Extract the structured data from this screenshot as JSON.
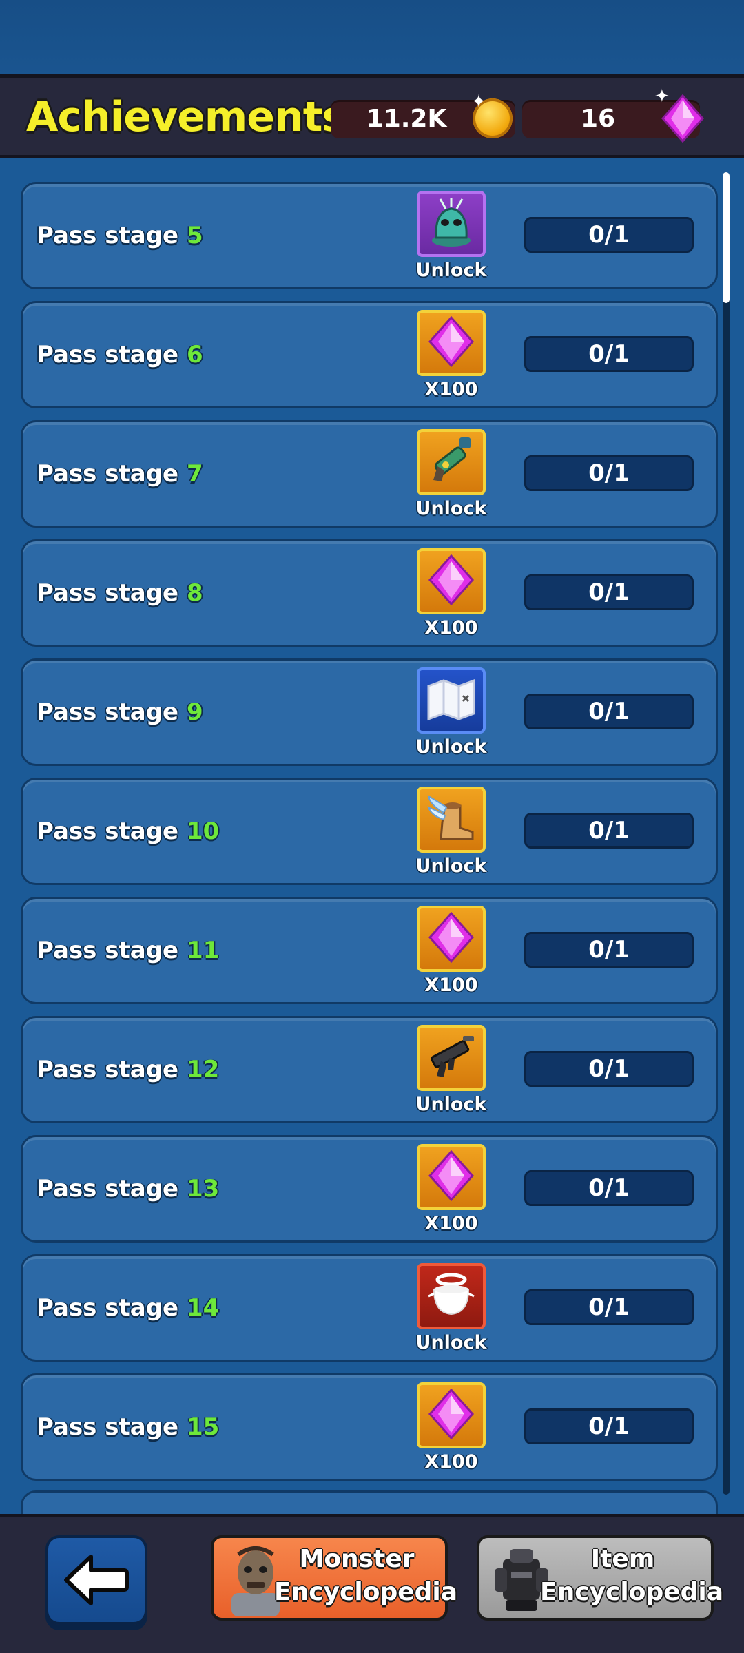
{
  "header": {
    "title": "Achievements",
    "coins": "11.2K",
    "gems": "16"
  },
  "achievements": [
    {
      "prefix": "Pass stage ",
      "stage": "5",
      "reward_icon": "monster-unlock-icon",
      "reward_style": "purple",
      "reward_label": "Unlock",
      "progress": "0/1",
      "progress_fraction": 0
    },
    {
      "prefix": "Pass stage ",
      "stage": "6",
      "reward_icon": "gem-icon",
      "reward_style": "gold",
      "reward_label": "X100",
      "progress": "0/1",
      "progress_fraction": 0
    },
    {
      "prefix": "Pass stage ",
      "stage": "7",
      "reward_icon": "raygun-icon",
      "reward_style": "gold",
      "reward_label": "Unlock",
      "progress": "0/1",
      "progress_fraction": 0
    },
    {
      "prefix": "Pass stage ",
      "stage": "8",
      "reward_icon": "gem-icon",
      "reward_style": "gold",
      "reward_label": "X100",
      "progress": "0/1",
      "progress_fraction": 0
    },
    {
      "prefix": "Pass stage ",
      "stage": "9",
      "reward_icon": "map-icon",
      "reward_style": "blue",
      "reward_label": "Unlock",
      "progress": "0/1",
      "progress_fraction": 0
    },
    {
      "prefix": "Pass stage ",
      "stage": "10",
      "reward_icon": "winged-boot-icon",
      "reward_style": "gold",
      "reward_label": "Unlock",
      "progress": "0/1",
      "progress_fraction": 0
    },
    {
      "prefix": "Pass stage ",
      "stage": "11",
      "reward_icon": "gem-icon",
      "reward_style": "gold",
      "reward_label": "X100",
      "progress": "0/1",
      "progress_fraction": 0
    },
    {
      "prefix": "Pass stage ",
      "stage": "12",
      "reward_icon": "smg-icon",
      "reward_style": "gold",
      "reward_label": "Unlock",
      "progress": "0/1",
      "progress_fraction": 0
    },
    {
      "prefix": "Pass stage ",
      "stage": "13",
      "reward_icon": "gem-icon",
      "reward_style": "gold",
      "reward_label": "X100",
      "progress": "0/1",
      "progress_fraction": 0
    },
    {
      "prefix": "Pass stage ",
      "stage": "14",
      "reward_icon": "halo-pot-icon",
      "reward_style": "red",
      "reward_label": "Unlock",
      "progress": "0/1",
      "progress_fraction": 0
    },
    {
      "prefix": "Pass stage ",
      "stage": "15",
      "reward_icon": "gem-icon",
      "reward_style": "gold",
      "reward_label": "X100",
      "progress": "0/1",
      "progress_fraction": 0
    }
  ],
  "footer": {
    "monster_line1": "Monster",
    "monster_line2": "Encyclopedia",
    "item_line1": "Item",
    "item_line2": "Encyclopedia"
  },
  "colors": {
    "title": "#f5ef2a",
    "stage_number": "#6ee83a",
    "background": "#1b5a97"
  }
}
